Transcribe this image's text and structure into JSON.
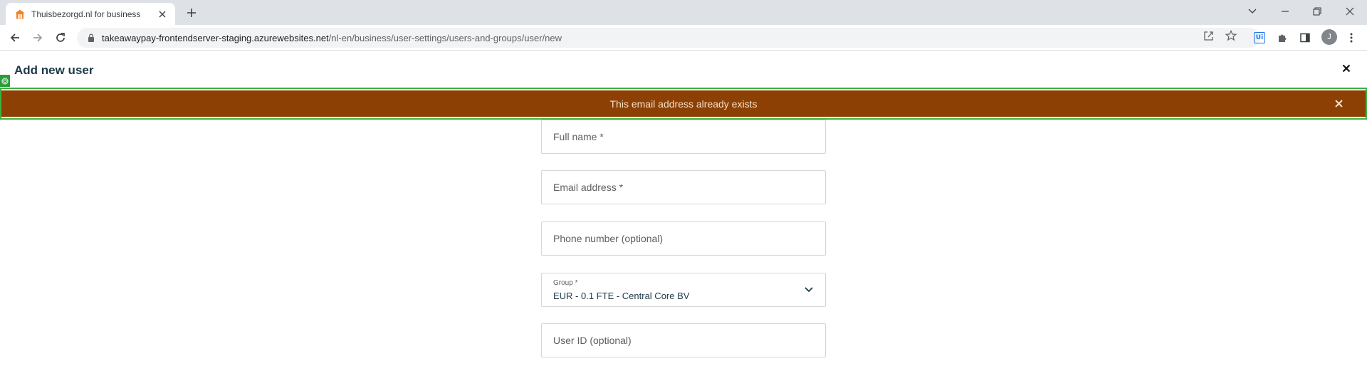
{
  "browser": {
    "tab_title": "Thuisbezorgd.nl for business",
    "url_host": "takeawaypay-frontendserver-staging.azurewebsites.net",
    "url_path": "/nl-en/business/user-settings/users-and-groups/user/new",
    "profile_initial": "J",
    "extension_badge": "Ui"
  },
  "page": {
    "title": "Add new user"
  },
  "alert": {
    "message": "This email address already exists",
    "background": "#8d4004"
  },
  "form": {
    "full_name_placeholder": "Full name *",
    "email_placeholder": "Email address *",
    "phone_placeholder": "Phone number (optional)",
    "group_label": "Group *",
    "group_value": "EUR - 0.1 FTE - Central Core BV",
    "user_id_placeholder": "User ID (optional)"
  },
  "colors": {
    "title": "#1d3a47",
    "accent_outline": "#3cb043",
    "brand_orange": "#f58220"
  },
  "icons": [
    "thuisbezorgd-favicon",
    "tab-close-icon",
    "new-tab-icon",
    "tab-search-icon",
    "minimize-icon",
    "restore-icon",
    "window-close-icon",
    "back-icon",
    "forward-icon",
    "reload-icon",
    "lock-icon",
    "share-icon",
    "star-icon",
    "extensions-icon",
    "side-panel-icon",
    "kebab-menu-icon",
    "close-icon",
    "chevron-down-icon"
  ]
}
